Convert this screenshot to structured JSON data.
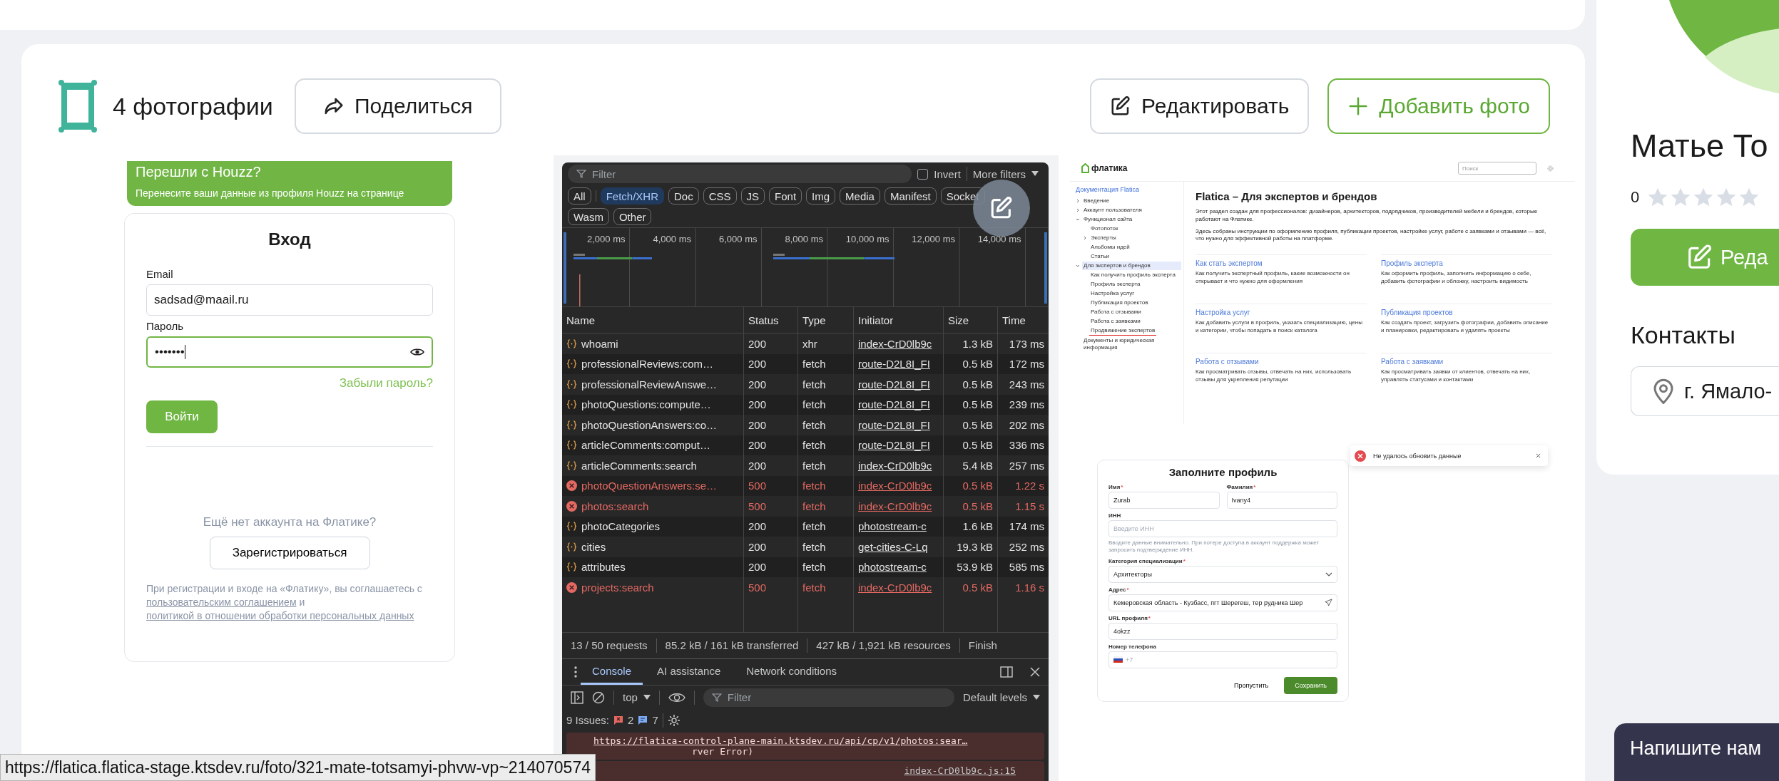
{
  "header": {
    "photo_count": "4 фотографии",
    "share_button": "Поделиться",
    "edit_button": "Редактировать",
    "add_photo_button": "Добавить фото"
  },
  "photos": [
    {
      "kind": "login",
      "banner_title": "Перешли с Houzz?",
      "banner_text": "Перенесите ваши данные из профиля Houzz на странице",
      "title": "Вход",
      "email_label": "Email",
      "email_value": "sadsad@maail.ru",
      "password_label": "Пароль",
      "password_value": "•••••••",
      "password_focused": true,
      "forgot_link": "Забыли пароль?",
      "login_button": "Войти",
      "no_account": "Ещё нет аккаунта на Флатике?",
      "register_button": "Зарегистрироваться",
      "legal_start": "При регистрации и входе на «Флатику», вы соглашаетесь с",
      "legal_link_1": "пользовательским соглашением",
      "legal_middle": "и",
      "legal_link_2": "политикой в отношении обработки персональных данных"
    },
    {
      "kind": "devtools",
      "filter_placeholder": "Filter",
      "invert_label": "Invert",
      "invert_checked": false,
      "more_filters": "More filters",
      "chips": [
        {
          "label": "All",
          "selected": false
        },
        {
          "label": "Fetch/XHR",
          "selected": true
        },
        {
          "label": "Doc",
          "selected": false
        },
        {
          "label": "CSS",
          "selected": false
        },
        {
          "label": "JS",
          "selected": false
        },
        {
          "label": "Font",
          "selected": false
        },
        {
          "label": "Img",
          "selected": false
        },
        {
          "label": "Media",
          "selected": false
        },
        {
          "label": "Manifest",
          "selected": false
        },
        {
          "label": "Socket",
          "selected": false
        },
        {
          "label": "Wasm",
          "selected": false
        },
        {
          "label": "Other",
          "selected": false
        }
      ],
      "timeline_labels": [
        "2,000 ms",
        "4,000 ms",
        "6,000 ms",
        "8,000 ms",
        "10,000 ms",
        "12,000 ms",
        "14,000 ms"
      ],
      "columns": [
        "Name",
        "Status",
        "Type",
        "Initiator",
        "Size",
        "Time"
      ],
      "rows": [
        {
          "name": "whoami",
          "status": "200",
          "type": "xhr",
          "initiator": "index-CrD0lb9c",
          "size": "1.3 kB",
          "time": "173 ms",
          "failed": false
        },
        {
          "name": "professionalReviews:com…",
          "status": "200",
          "type": "fetch",
          "initiator": "route-D2L8I_FI",
          "size": "0.5 kB",
          "time": "172 ms",
          "failed": false
        },
        {
          "name": "professionalReviewAnswe…",
          "status": "200",
          "type": "fetch",
          "initiator": "route-D2L8I_FI",
          "size": "0.5 kB",
          "time": "243 ms",
          "failed": false
        },
        {
          "name": "photoQuestions:compute…",
          "status": "200",
          "type": "fetch",
          "initiator": "route-D2L8I_FI",
          "size": "0.5 kB",
          "time": "239 ms",
          "failed": false
        },
        {
          "name": "photoQuestionAnswers:co…",
          "status": "200",
          "type": "fetch",
          "initiator": "route-D2L8I_FI",
          "size": "0.5 kB",
          "time": "202 ms",
          "failed": false
        },
        {
          "name": "articleComments:comput…",
          "status": "200",
          "type": "fetch",
          "initiator": "route-D2L8I_FI",
          "size": "0.5 kB",
          "time": "336 ms",
          "failed": false
        },
        {
          "name": "articleComments:search",
          "status": "200",
          "type": "fetch",
          "initiator": "index-CrD0lb9c",
          "size": "5.4 kB",
          "time": "257 ms",
          "failed": false
        },
        {
          "name": "photoQuestionAnswers:se…",
          "status": "500",
          "type": "fetch",
          "initiator": "index-CrD0lb9c",
          "size": "0.5 kB",
          "time": "1.22 s",
          "failed": true
        },
        {
          "name": "photos:search",
          "status": "500",
          "type": "fetch",
          "initiator": "index-CrD0lb9c",
          "size": "0.5 kB",
          "time": "1.15 s",
          "failed": true
        },
        {
          "name": "photoCategories",
          "status": "200",
          "type": "fetch",
          "initiator": "photostream-c",
          "size": "1.6 kB",
          "time": "174 ms",
          "failed": false
        },
        {
          "name": "cities",
          "status": "200",
          "type": "fetch",
          "initiator": "get-cities-C-Lq",
          "size": "19.3 kB",
          "time": "252 ms",
          "failed": false
        },
        {
          "name": "attributes",
          "status": "200",
          "type": "fetch",
          "initiator": "photostream-c",
          "size": "53.9 kB",
          "time": "585 ms",
          "failed": false
        },
        {
          "name": "projects:search",
          "status": "500",
          "type": "fetch",
          "initiator": "index-CrD0lb9c",
          "size": "0.5 kB",
          "time": "1.16 s",
          "failed": true
        }
      ],
      "summary": [
        "13 / 50 requests",
        "85.2 kB / 161 kB transferred",
        "427 kB / 1,921 kB resources",
        "Finish"
      ],
      "drawer_tabs": [
        {
          "label": "Console",
          "selected": true
        },
        {
          "label": "AI assistance",
          "selected": false
        },
        {
          "label": "Network conditions",
          "selected": false
        }
      ],
      "context": "top",
      "console_filter_placeholder": "Filter",
      "levels": "Default levels",
      "issues_label": "9 Issues:",
      "error_count": "2",
      "info_count": "7",
      "error_url": "https://flatica-control-plane-main.ktsdev.ru/api/cp/v1/photos:sear…",
      "error_detail": "rver Error)",
      "message_source": "index-CrD0lb9c.js:15"
    },
    {
      "kind": "docs",
      "logo": "флатика",
      "search_placeholder": "Поиск",
      "sidebar_title": "Документация Flatica",
      "nav": [
        {
          "label": "Введение",
          "selected": false,
          "underlined": false,
          "expanded": false
        },
        {
          "label": "Аккаунт пользователя",
          "selected": false,
          "underlined": false,
          "expanded": false
        },
        {
          "label": "Функционал сайта",
          "selected": false,
          "underlined": false,
          "expanded": true,
          "children": [
            {
              "label": "Фотопоток",
              "selected": false,
              "underlined": false
            },
            {
              "label": "Эксперты",
              "selected": false,
              "underlined": false,
              "expanded": false
            },
            {
              "label": "Альбомы идей",
              "selected": false,
              "underlined": false
            },
            {
              "label": "Статьи",
              "selected": false,
              "underlined": false
            }
          ]
        },
        {
          "label": "Для экспертов и брендов",
          "selected": true,
          "underlined": false,
          "expanded": true,
          "children": [
            {
              "label": "Как получить профиль эксперта",
              "selected": false,
              "underlined": false
            },
            {
              "label": "Профиль эксперта",
              "selected": false,
              "underlined": false
            },
            {
              "label": "Настройка услуг",
              "selected": false,
              "underlined": false
            },
            {
              "label": "Публикация проектов",
              "selected": false,
              "underlined": false
            },
            {
              "label": "Работа с отзывами",
              "selected": false,
              "underlined": false
            },
            {
              "label": "Работа с заявками",
              "selected": false,
              "underlined": false
            },
            {
              "label": "Продвижение экспертов",
              "selected": false,
              "underlined": true
            }
          ]
        },
        {
          "label": "Документы и юридическая информация",
          "selected": false,
          "underlined": false
        }
      ],
      "title": "Flatica – Для экспертов и брендов",
      "paragraphs": [
        "Этот раздел создан для профессионалов: дизайнеров, архитекторов, подрядчиков, производителей мебели и брендов, которые работают на Флатике.",
        "Здесь собраны инструкции по оформлению профиля, публикации проектов, настройке услуг, работе с заявками и отзывами — всё, что нужно для эффективной работы на платформе."
      ],
      "cards": [
        {
          "title": "Как стать экспертом",
          "text": "Как получить экспертный профиль, какие возможности он открывает и что нужно для оформления"
        },
        {
          "title": "Профиль эксперта",
          "text": "Как оформить профиль, заполнить информацию о себе, добавить фотографии и обложку, настроить видимость"
        },
        {
          "title": "Настройка услуг",
          "text": "Как добавить услуги в профиль, указать специализацию, цены и категории, чтобы попадать в поиск каталога"
        },
        {
          "title": "Публикация проектов",
          "text": "Как создать проект, загрузить фотографии, добавить описание и планировки, редактировать и удалять проекты"
        },
        {
          "title": "Работа с отзывами",
          "text": "Как просматривать отзывы, отвечать на них, использовать отзывы для укрепления репутации"
        },
        {
          "title": "Работа с заявками",
          "text": "Как просматривать заявки от клиентов, отвечать на них, управлять статусами и контактами"
        }
      ],
      "toast": "Не удалось обновить данные",
      "form": {
        "title": "Заполните профиль",
        "fields": [
          {
            "kind": "half",
            "label": "Имя",
            "required_mark": "*",
            "value": "Zurab"
          },
          {
            "kind": "half",
            "label": "Фамилия",
            "required_mark": "*",
            "value": "Ivany4"
          },
          {
            "kind": "text",
            "label": "ИНН",
            "placeholder": "Введите ИНН",
            "hint": "Вводите данные внимательно. При потере доступа в аккаунт поддержка может запросить подтверждение ИНН."
          },
          {
            "kind": "select",
            "label": "Категория специализации",
            "required_mark": "*",
            "value": "Архитекторы"
          },
          {
            "kind": "address",
            "label": "Адрес",
            "required_mark": "*",
            "value": "Кемеровская область - Кузбасс, пгт Шерегеш, тер рудника Шер"
          },
          {
            "kind": "text",
            "label": "URL профиля",
            "required_mark": "*",
            "value": "4okzz"
          },
          {
            "kind": "phone",
            "label": "Номер телефона",
            "placeholder": "+7"
          }
        ],
        "skip_button": "Пропустить",
        "save_button": "Сохранить"
      }
    }
  ],
  "profile": {
    "name": "Матье То",
    "rating": "0",
    "stars": 0,
    "edit_button": "Реда",
    "contacts_title": "Контакты",
    "location": "г. Ямало-"
  },
  "chat_widget": "Напишите нам",
  "status_url": "https://flatica.flatica-stage.ktsdev.ru/foto/321-mate-totsamyi-phvw-vp~214070574"
}
